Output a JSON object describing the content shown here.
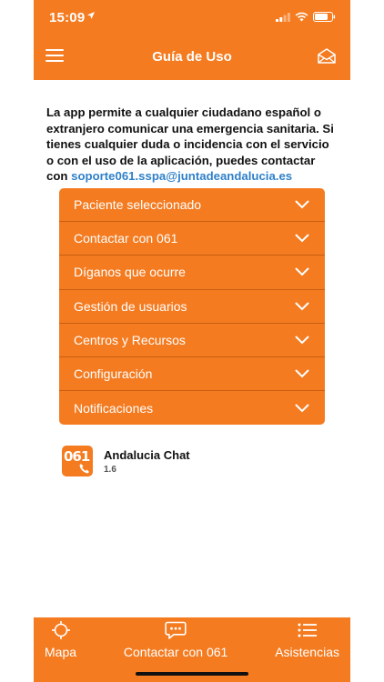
{
  "status": {
    "time": "15:09"
  },
  "header": {
    "title": "Guía de Uso"
  },
  "intro": {
    "text": "La app permite a cualquier ciudadano español o extranjero comunicar una emergencia sanitaria. Si tienes cualquier duda o incidencia con el servicio o con el uso de la aplicación, puedes contactar con",
    "email": "soporte061.sspa@juntadeandalucia.es"
  },
  "accordion": [
    {
      "label": "Paciente seleccionado"
    },
    {
      "label": "Contactar con 061"
    },
    {
      "label": "Díganos que ocurre"
    },
    {
      "label": "Gestión de usuarios"
    },
    {
      "label": "Centros y Recursos"
    },
    {
      "label": "Configuración"
    },
    {
      "label": "Notificaciones"
    }
  ],
  "app": {
    "logo_text": "061",
    "name": "Andalucia Chat",
    "version": "1.6"
  },
  "tabs": [
    {
      "label": "Mapa",
      "icon": "crosshair-icon"
    },
    {
      "label": "Contactar con 061",
      "icon": "chat-icon"
    },
    {
      "label": "Asistencias",
      "icon": "list-icon"
    }
  ],
  "colors": {
    "primary": "#f47b20",
    "link": "#2f80c9"
  }
}
